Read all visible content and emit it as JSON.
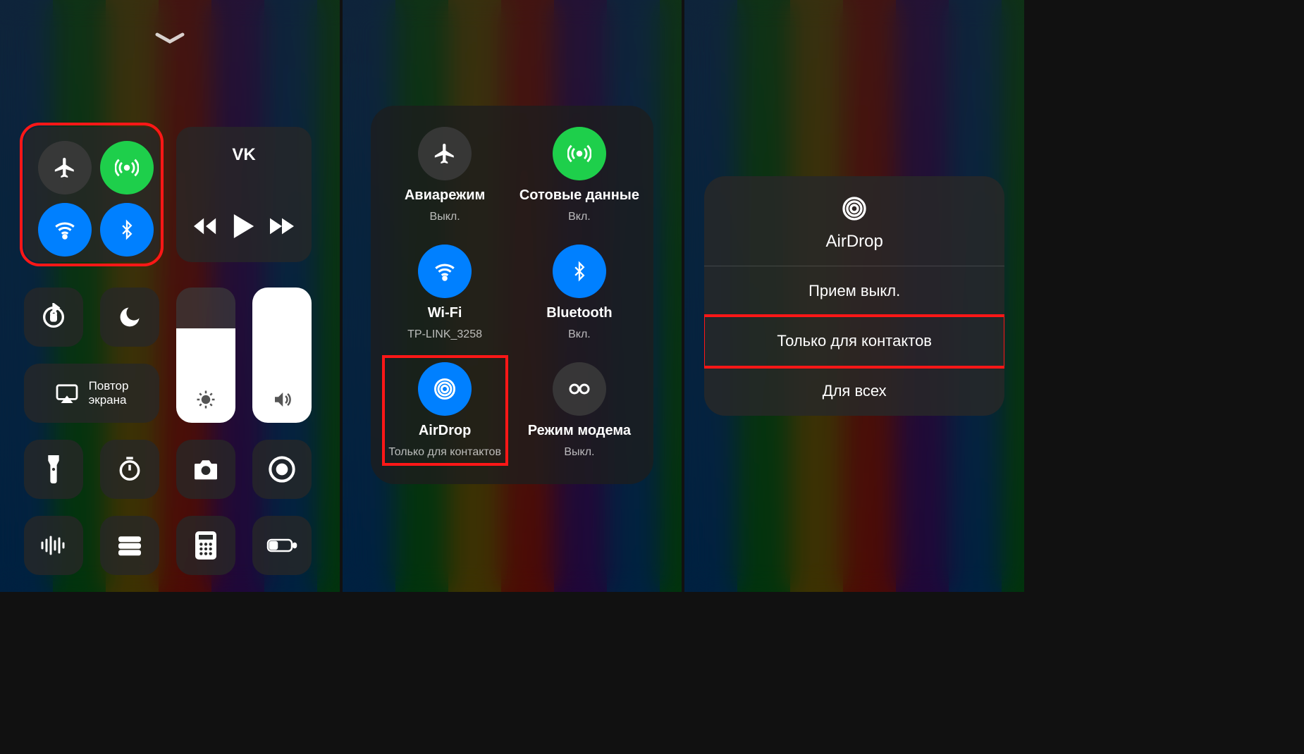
{
  "panel1": {
    "media_source": "VK",
    "mirror_label": "Повтор\nэкрана",
    "brightness_fill_pct": 70,
    "volume_fill_pct": 100
  },
  "panel2": {
    "airplane": {
      "title": "Авиарежим",
      "sub": "Выкл."
    },
    "cellular": {
      "title": "Сотовые данные",
      "sub": "Вкл."
    },
    "wifi": {
      "title": "Wi-Fi",
      "sub": "TP-LINK_3258"
    },
    "bluetooth": {
      "title": "Bluetooth",
      "sub": "Вкл."
    },
    "airdrop": {
      "title": "AirDrop",
      "sub": "Только для контактов"
    },
    "hotspot": {
      "title": "Режим модема",
      "sub": "Выкл."
    }
  },
  "panel3": {
    "title": "AirDrop",
    "options": [
      "Прием выкл.",
      "Только для контактов",
      "Для всех"
    ],
    "highlight_index": 1
  }
}
